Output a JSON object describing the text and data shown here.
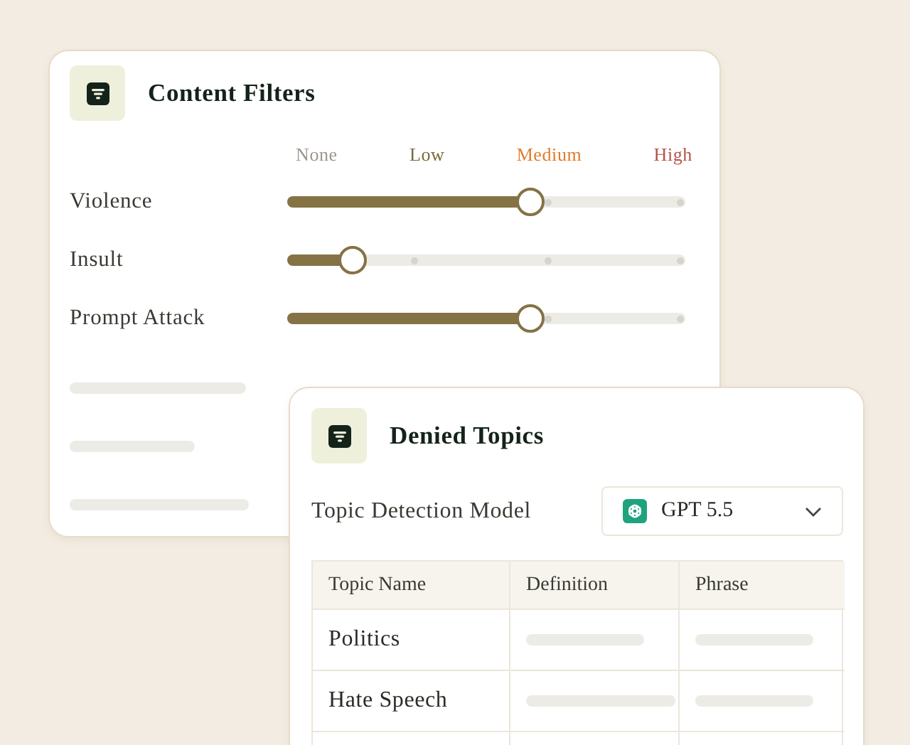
{
  "content_filters": {
    "title": "Content Filters",
    "levels": [
      {
        "label": "None",
        "color": "#9b978f"
      },
      {
        "label": "Low",
        "color": "#7d6a3d"
      },
      {
        "label": "Medium",
        "color": "#e07b2a"
      },
      {
        "label": "High",
        "color": "#b5544a"
      }
    ],
    "filters": [
      {
        "name": "Violence",
        "level": 0.61
      },
      {
        "name": "Insult",
        "level": 0.165
      },
      {
        "name": "Prompt Attack",
        "level": 0.61
      }
    ]
  },
  "denied_topics": {
    "title": "Denied Topics",
    "model": {
      "label": "Topic Detection Model",
      "value": "GPT 5.5"
    },
    "table": {
      "columns": [
        "Topic Name",
        "Definition",
        "Phrase"
      ],
      "rows": [
        {
          "topic_name": "Politics"
        },
        {
          "topic_name": "Hate Speech"
        }
      ]
    }
  }
}
